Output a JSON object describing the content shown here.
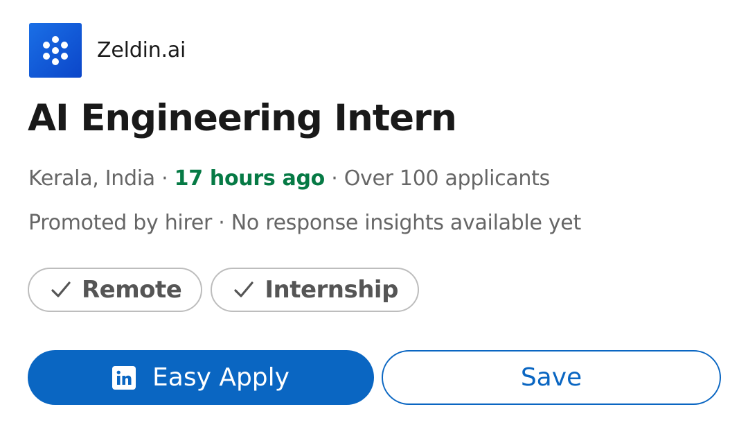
{
  "company": {
    "name": "Zeldin.ai",
    "logo_icon": "zeldin-dots-logo-icon",
    "logo_color": "#0b46c9"
  },
  "job": {
    "title": "AI Engineering Intern",
    "location": "Kerala, India",
    "separator": "·",
    "posted": "17 hours ago",
    "applicants": "Over 100 applicants",
    "promoted": "Promoted by hirer",
    "insights": "No response insights available yet"
  },
  "chips": [
    {
      "label": "Remote",
      "icon": "checkmark-icon"
    },
    {
      "label": "Internship",
      "icon": "checkmark-icon"
    }
  ],
  "actions": {
    "apply_label": "Easy Apply",
    "apply_icon": "linkedin-icon",
    "save_label": "Save"
  },
  "colors": {
    "brand_blue": "#0a66c2",
    "posted_green": "#067a45",
    "muted_text": "#666666",
    "title_text": "#191919"
  }
}
